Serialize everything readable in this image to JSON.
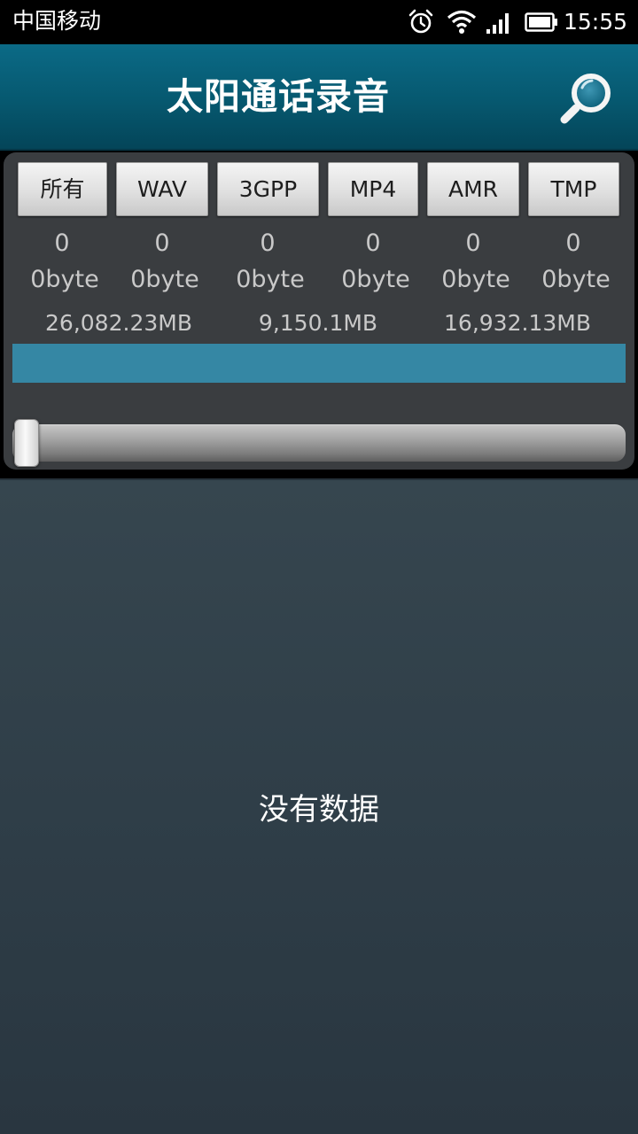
{
  "status_bar": {
    "carrier": "中国移动",
    "time": "15:55",
    "icons": [
      "alarm-icon",
      "wifi-icon",
      "signal-icon",
      "battery-icon"
    ]
  },
  "header": {
    "title": "太阳通话录音",
    "search_icon": "search-icon"
  },
  "filters": {
    "tabs": [
      {
        "label": "所有",
        "count": "0",
        "size": "0byte"
      },
      {
        "label": "WAV",
        "count": "0",
        "size": "0byte"
      },
      {
        "label": "3GPP",
        "count": "0",
        "size": "0byte"
      },
      {
        "label": "MP4",
        "count": "0",
        "size": "0byte"
      },
      {
        "label": "AMR",
        "count": "0",
        "size": "0byte"
      },
      {
        "label": "TMP",
        "count": "0",
        "size": "0byte"
      }
    ]
  },
  "storage": {
    "total": "26,082.23MB",
    "used": "9,150.1MB",
    "free": "16,932.13MB",
    "used_fraction": 1.0
  },
  "slider": {
    "position_fraction": 0.0
  },
  "list": {
    "empty_message": "没有数据"
  },
  "colors": {
    "header": "#06586f",
    "usage_bar": "#3587a4",
    "list_background": "#2f3e48",
    "panel_background": "#3a3d40"
  }
}
